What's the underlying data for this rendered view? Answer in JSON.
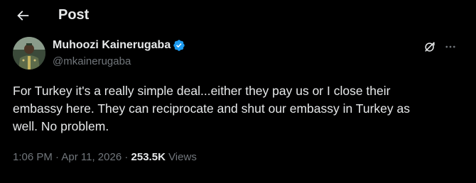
{
  "header": {
    "title": "Post",
    "back_icon": "arrow-left-icon"
  },
  "author": {
    "display_name": "Muhoozi Kainerugaba",
    "handle": "@mkainerugaba",
    "verified_icon": "verified-badge-icon",
    "verified_color": "#1d9bf0",
    "grok_icon": "grok-icon",
    "more_icon": "more-options-icon"
  },
  "tweet": {
    "text": "For Turkey it's a really simple deal...either they pay us or I close their\nembassy here. They can reciprocate and shut our embassy in Turkey as\nwell. No problem."
  },
  "meta": {
    "time": "1:06 PM",
    "separator": "·",
    "date": "Apr 11, 2026",
    "views_count": "253.5K",
    "views_label": "Views"
  },
  "colors": {
    "background": "#000000",
    "primary_text": "#e7e9ea",
    "secondary_text": "#71767b",
    "accent": "#1d9bf0"
  }
}
